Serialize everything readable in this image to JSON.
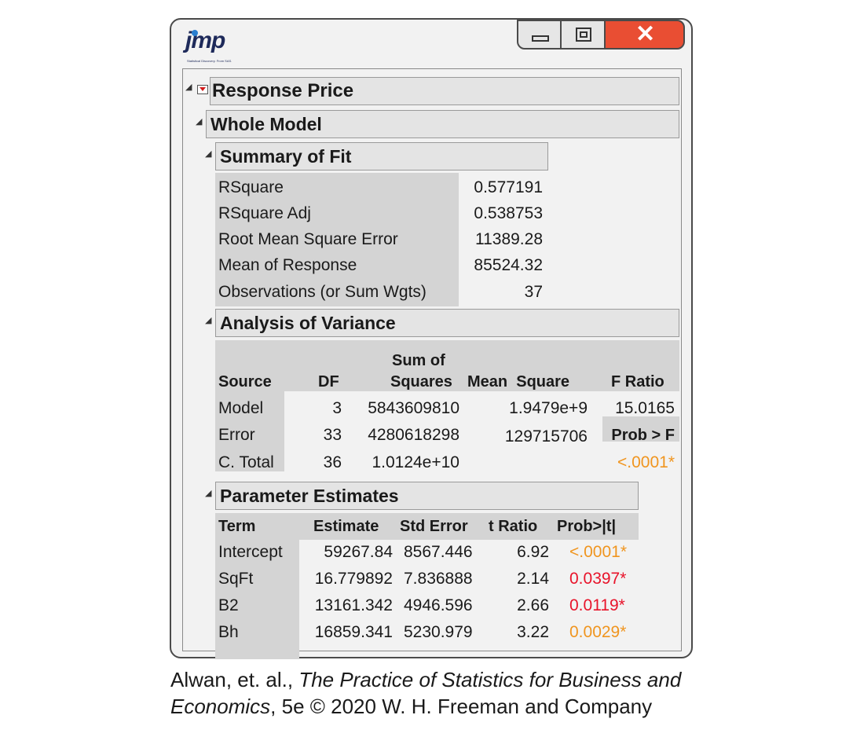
{
  "app": {
    "logo": "jmp",
    "logo_sub": "Statistical Discovery. From SAS."
  },
  "icons": [
    "minimize-icon",
    "maximize-icon",
    "close-icon",
    "disclosure-triangle-icon",
    "red-triangle-menu-icon"
  ],
  "colors": {
    "close_button": "#e94e33",
    "pvalue_orange": "#f0951f",
    "pvalue_red": "#e8132a"
  },
  "report": {
    "title": "Response Price",
    "whole_model": "Whole Model",
    "summary_of_fit": {
      "title": "Summary of Fit",
      "rows": [
        {
          "label": "RSquare",
          "value": "0.577191"
        },
        {
          "label": "RSquare Adj",
          "value": "0.538753"
        },
        {
          "label": "Root Mean Square Error",
          "value": "11389.28"
        },
        {
          "label": "Mean of Response",
          "value": "85524.32"
        },
        {
          "label": "Observations (or Sum Wgts)",
          "value": "37"
        }
      ]
    },
    "anova": {
      "title": "Analysis of Variance",
      "headers": {
        "source": "Source",
        "df": "DF",
        "ss_top": "Sum of",
        "ss_bottom": "Squares",
        "ms": "Mean  Square",
        "f": "F Ratio"
      },
      "rows": [
        {
          "source": "Model",
          "df": "3",
          "ss": "5843609810",
          "ms": "1.9479e+9",
          "f": "15.0165"
        },
        {
          "source": "Error",
          "df": "33",
          "ss": "4280618298",
          "ms": "129715706",
          "f": "Prob > F"
        },
        {
          "source": "C. Total",
          "df": "36",
          "ss": "1.0124e+10",
          "ms": "",
          "f": "<.0001*"
        }
      ]
    },
    "parameter_estimates": {
      "title": "Parameter Estimates",
      "headers": {
        "term": "Term",
        "estimate": "Estimate",
        "std_error": "Std Error",
        "t_ratio": "t Ratio",
        "prob": "Prob>|t|"
      },
      "rows": [
        {
          "term": "Intercept",
          "estimate": "59267.84",
          "std_error": "8567.446",
          "t_ratio": "6.92",
          "prob": "<.0001*"
        },
        {
          "term": "SqFt",
          "estimate": "16.779892",
          "std_error": "7.836888",
          "t_ratio": "2.14",
          "prob": "0.0397*"
        },
        {
          "term": "B2",
          "estimate": "13161.342",
          "std_error": "4946.596",
          "t_ratio": "2.66",
          "prob": "0.0119*"
        },
        {
          "term": "Bh",
          "estimate": "16859.341",
          "std_error": "5230.979",
          "t_ratio": "3.22",
          "prob": "0.0029*"
        }
      ]
    }
  },
  "caption": {
    "line1_pre": "Alwan, et. al., ",
    "line1_italic": "The Practice of Statistics for Business and",
    "line2_italic": "Economics",
    "line2_post": ", 5e © 2020 W. H. Freeman and Company"
  }
}
